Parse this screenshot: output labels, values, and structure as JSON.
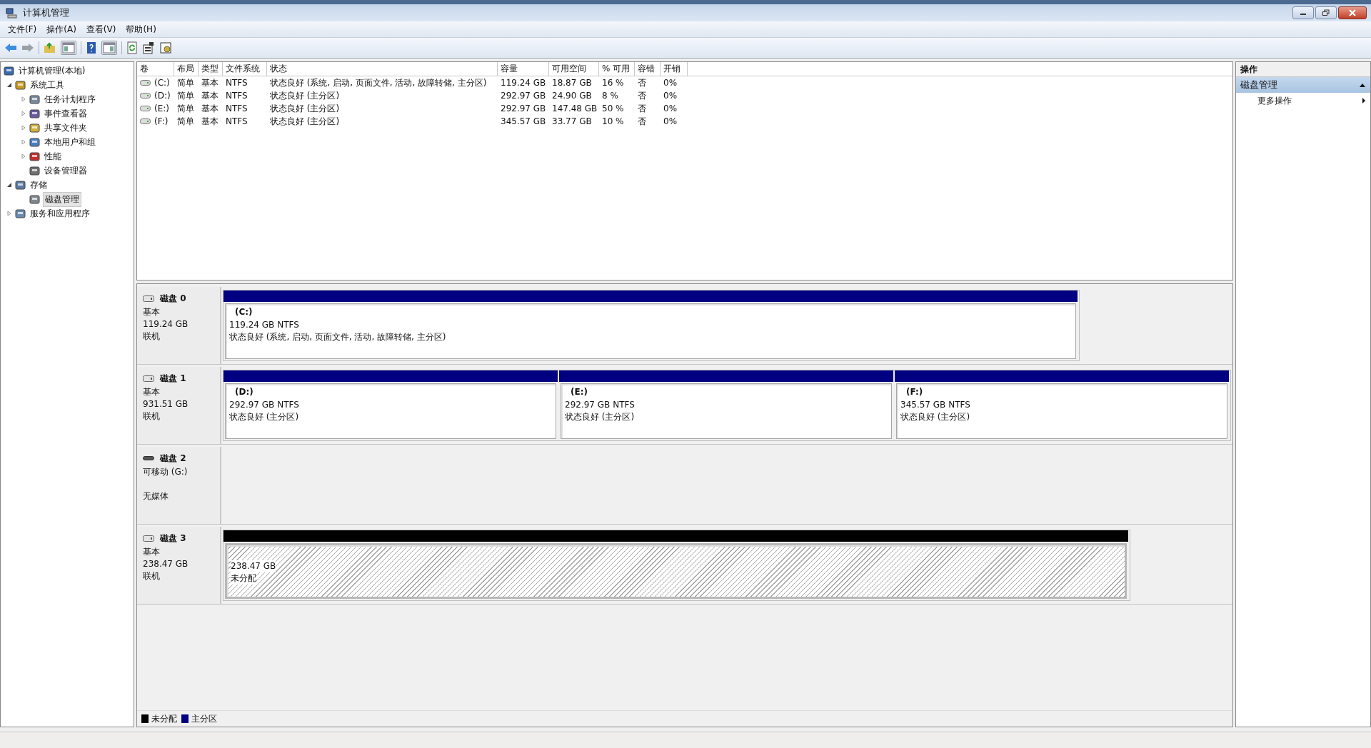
{
  "window": {
    "title": "计算机管理"
  },
  "menu": [
    "文件(F)",
    "操作(A)",
    "查看(V)",
    "帮助(H)"
  ],
  "tree": [
    {
      "label": "计算机管理(本地)",
      "selected": false,
      "children": [
        {
          "label": "系统工具",
          "expanded": true,
          "selected": false,
          "children": [
            {
              "label": "任务计划程序",
              "expanded": false,
              "selected": false
            },
            {
              "label": "事件查看器",
              "expanded": false,
              "selected": false
            },
            {
              "label": "共享文件夹",
              "expanded": false,
              "selected": false
            },
            {
              "label": "本地用户和组",
              "expanded": false,
              "selected": false
            },
            {
              "label": "性能",
              "expanded": false,
              "selected": false
            },
            {
              "label": "设备管理器",
              "selected": false
            }
          ]
        },
        {
          "label": "存储",
          "expanded": true,
          "selected": false,
          "children": [
            {
              "label": "磁盘管理",
              "selected": true
            }
          ]
        },
        {
          "label": "服务和应用程序",
          "expanded": false,
          "selected": false
        }
      ]
    }
  ],
  "table": {
    "columns": [
      "卷",
      "布局",
      "类型",
      "文件系统",
      "状态",
      "容量",
      "可用空间",
      "% 可用",
      "容错",
      "开销"
    ],
    "rows": [
      [
        "(C:)",
        "简单",
        "基本",
        "NTFS",
        "状态良好 (系统, 启动, 页面文件, 活动, 故障转储, 主分区)",
        "119.24 GB",
        "18.87 GB",
        "16 %",
        "否",
        "0%"
      ],
      [
        "(D:)",
        "简单",
        "基本",
        "NTFS",
        "状态良好 (主分区)",
        "292.97 GB",
        "24.90 GB",
        "8 %",
        "否",
        "0%"
      ],
      [
        "(E:)",
        "简单",
        "基本",
        "NTFS",
        "状态良好 (主分区)",
        "292.97 GB",
        "147.48 GB",
        "50 %",
        "否",
        "0%"
      ],
      [
        "(F:)",
        "简单",
        "基本",
        "NTFS",
        "状态良好 (主分区)",
        "345.57 GB",
        "33.77 GB",
        "10 %",
        "否",
        "0%"
      ]
    ]
  },
  "disks": [
    {
      "name": "磁盘 0",
      "kind": "fixed",
      "lines": [
        "基本",
        "119.24 GB",
        "联机"
      ],
      "partitions": [
        {
          "kind": "primary",
          "name": "(C:)",
          "size": "119.24 GB NTFS",
          "status": "状态良好 (系统, 启动, 页面文件, 活动, 故障转储, 主分区)"
        }
      ]
    },
    {
      "name": "磁盘 1",
      "kind": "fixed",
      "lines": [
        "基本",
        "931.51 GB",
        "联机"
      ],
      "partitions": [
        {
          "kind": "primary",
          "name": "(D:)",
          "size": "292.97 GB NTFS",
          "status": "状态良好 (主分区)"
        },
        {
          "kind": "primary",
          "name": "(E:)",
          "size": "292.97 GB NTFS",
          "status": "状态良好 (主分区)"
        },
        {
          "kind": "primary",
          "name": "(F:)",
          "size": "345.57 GB NTFS",
          "status": "状态良好 (主分区)"
        }
      ]
    },
    {
      "name": "磁盘 2",
      "kind": "removable",
      "lines": [
        "可移动 (G:)",
        "无媒体"
      ]
    },
    {
      "name": "磁盘 3",
      "kind": "fixed",
      "lines": [
        "基本",
        "238.47 GB",
        "联机"
      ],
      "partitions": [
        {
          "kind": "unallocated",
          "size": "238.47 GB",
          "status": "未分配"
        }
      ]
    }
  ],
  "legend": [
    {
      "label": "未分配",
      "color": "#000000"
    },
    {
      "label": "主分区",
      "color": "#000080"
    }
  ],
  "actions": {
    "title": "操作",
    "section": {
      "label": "磁盘管理",
      "expanded": true,
      "items": [
        "更多操作"
      ]
    }
  }
}
